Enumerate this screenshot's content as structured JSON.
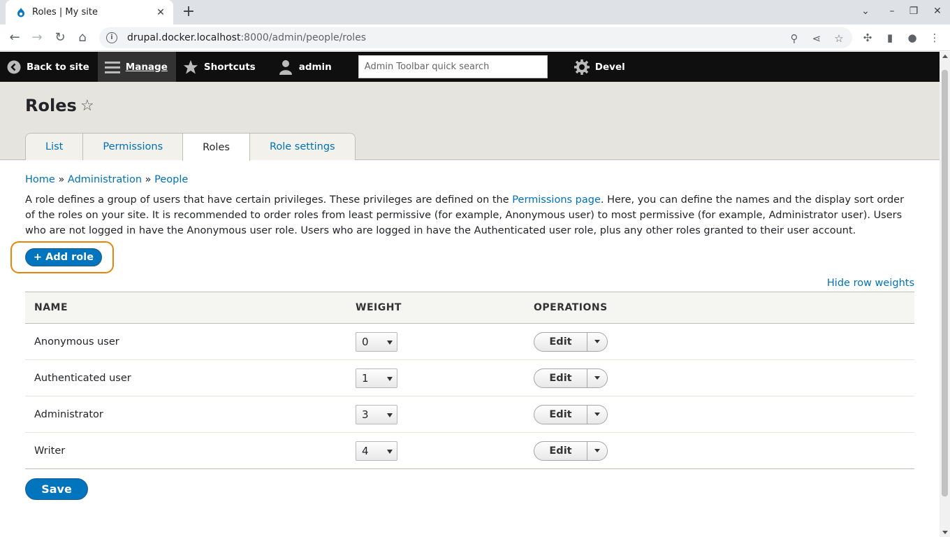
{
  "browser": {
    "tab_title": "Roles | My site",
    "url_host": "drupal.docker.localhost",
    "url_rest": ":8000/admin/people/roles"
  },
  "admin_toolbar": {
    "back_to_site": "Back to site",
    "manage": "Manage",
    "shortcuts": "Shortcuts",
    "user": "admin",
    "search_placeholder": "Admin Toolbar quick search",
    "devel": "Devel"
  },
  "header": {
    "title": "Roles",
    "tabs": [
      {
        "label": "List"
      },
      {
        "label": "Permissions"
      },
      {
        "label": "Roles"
      },
      {
        "label": "Role settings"
      }
    ]
  },
  "breadcrumb": {
    "home": "Home",
    "sep": "»",
    "administration": "Administration",
    "people": "People"
  },
  "description": {
    "before_link": "A role defines a group of users that have certain privileges. These privileges are defined on the ",
    "link": "Permissions page",
    "after_link": ". Here, you can define the names and the display sort order of the roles on your site. It is recommended to order roles from least permissive (for example, Anonymous user) to most permissive (for example, Administrator user). Users who are not logged in have the Anonymous user role. Users who are logged in have the Authenticated user role, plus any other roles granted to their user account."
  },
  "actions": {
    "add_role": "+ Add role",
    "hide_row_weights": "Hide row weights",
    "save": "Save"
  },
  "table": {
    "headers": [
      "NAME",
      "WEIGHT",
      "OPERATIONS"
    ],
    "rows": [
      {
        "name": "Anonymous user",
        "weight": "0",
        "op": "Edit"
      },
      {
        "name": "Authenticated user",
        "weight": "1",
        "op": "Edit"
      },
      {
        "name": "Administrator",
        "weight": "3",
        "op": "Edit"
      },
      {
        "name": "Writer",
        "weight": "4",
        "op": "Edit"
      }
    ]
  },
  "colors": {
    "link": "#0071b8",
    "primary_button": "#0074bd",
    "highlight_outline": "#e9840a",
    "admin_bar": "#0f0f0f"
  }
}
